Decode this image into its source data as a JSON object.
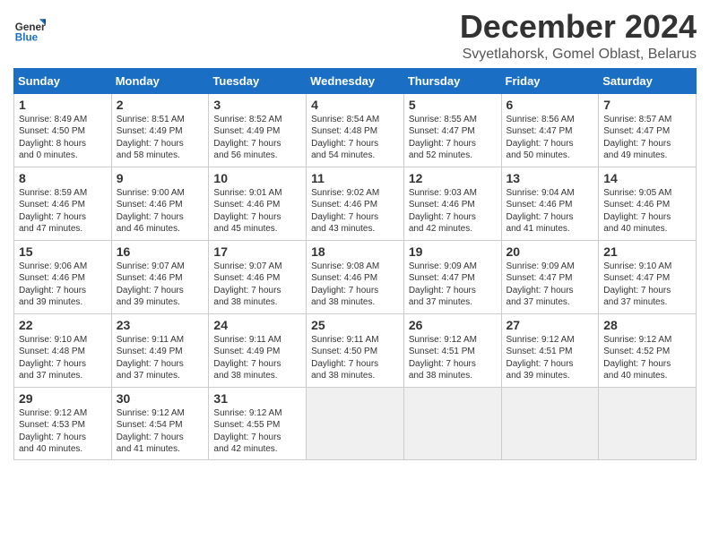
{
  "logo": {
    "general": "General",
    "blue": "Blue"
  },
  "title": "December 2024",
  "location": "Svyetlahorsk, Gomel Oblast, Belarus",
  "days_header": [
    "Sunday",
    "Monday",
    "Tuesday",
    "Wednesday",
    "Thursday",
    "Friday",
    "Saturday"
  ],
  "weeks": [
    [
      {
        "day": "1",
        "info": "Sunrise: 8:49 AM\nSunset: 4:50 PM\nDaylight: 8 hours\nand 0 minutes."
      },
      {
        "day": "2",
        "info": "Sunrise: 8:51 AM\nSunset: 4:49 PM\nDaylight: 7 hours\nand 58 minutes."
      },
      {
        "day": "3",
        "info": "Sunrise: 8:52 AM\nSunset: 4:49 PM\nDaylight: 7 hours\nand 56 minutes."
      },
      {
        "day": "4",
        "info": "Sunrise: 8:54 AM\nSunset: 4:48 PM\nDaylight: 7 hours\nand 54 minutes."
      },
      {
        "day": "5",
        "info": "Sunrise: 8:55 AM\nSunset: 4:47 PM\nDaylight: 7 hours\nand 52 minutes."
      },
      {
        "day": "6",
        "info": "Sunrise: 8:56 AM\nSunset: 4:47 PM\nDaylight: 7 hours\nand 50 minutes."
      },
      {
        "day": "7",
        "info": "Sunrise: 8:57 AM\nSunset: 4:47 PM\nDaylight: 7 hours\nand 49 minutes."
      }
    ],
    [
      {
        "day": "8",
        "info": "Sunrise: 8:59 AM\nSunset: 4:46 PM\nDaylight: 7 hours\nand 47 minutes."
      },
      {
        "day": "9",
        "info": "Sunrise: 9:00 AM\nSunset: 4:46 PM\nDaylight: 7 hours\nand 46 minutes."
      },
      {
        "day": "10",
        "info": "Sunrise: 9:01 AM\nSunset: 4:46 PM\nDaylight: 7 hours\nand 45 minutes."
      },
      {
        "day": "11",
        "info": "Sunrise: 9:02 AM\nSunset: 4:46 PM\nDaylight: 7 hours\nand 43 minutes."
      },
      {
        "day": "12",
        "info": "Sunrise: 9:03 AM\nSunset: 4:46 PM\nDaylight: 7 hours\nand 42 minutes."
      },
      {
        "day": "13",
        "info": "Sunrise: 9:04 AM\nSunset: 4:46 PM\nDaylight: 7 hours\nand 41 minutes."
      },
      {
        "day": "14",
        "info": "Sunrise: 9:05 AM\nSunset: 4:46 PM\nDaylight: 7 hours\nand 40 minutes."
      }
    ],
    [
      {
        "day": "15",
        "info": "Sunrise: 9:06 AM\nSunset: 4:46 PM\nDaylight: 7 hours\nand 39 minutes."
      },
      {
        "day": "16",
        "info": "Sunrise: 9:07 AM\nSunset: 4:46 PM\nDaylight: 7 hours\nand 39 minutes."
      },
      {
        "day": "17",
        "info": "Sunrise: 9:07 AM\nSunset: 4:46 PM\nDaylight: 7 hours\nand 38 minutes."
      },
      {
        "day": "18",
        "info": "Sunrise: 9:08 AM\nSunset: 4:46 PM\nDaylight: 7 hours\nand 38 minutes."
      },
      {
        "day": "19",
        "info": "Sunrise: 9:09 AM\nSunset: 4:47 PM\nDaylight: 7 hours\nand 37 minutes."
      },
      {
        "day": "20",
        "info": "Sunrise: 9:09 AM\nSunset: 4:47 PM\nDaylight: 7 hours\nand 37 minutes."
      },
      {
        "day": "21",
        "info": "Sunrise: 9:10 AM\nSunset: 4:47 PM\nDaylight: 7 hours\nand 37 minutes."
      }
    ],
    [
      {
        "day": "22",
        "info": "Sunrise: 9:10 AM\nSunset: 4:48 PM\nDaylight: 7 hours\nand 37 minutes."
      },
      {
        "day": "23",
        "info": "Sunrise: 9:11 AM\nSunset: 4:49 PM\nDaylight: 7 hours\nand 37 minutes."
      },
      {
        "day": "24",
        "info": "Sunrise: 9:11 AM\nSunset: 4:49 PM\nDaylight: 7 hours\nand 38 minutes."
      },
      {
        "day": "25",
        "info": "Sunrise: 9:11 AM\nSunset: 4:50 PM\nDaylight: 7 hours\nand 38 minutes."
      },
      {
        "day": "26",
        "info": "Sunrise: 9:12 AM\nSunset: 4:51 PM\nDaylight: 7 hours\nand 38 minutes."
      },
      {
        "day": "27",
        "info": "Sunrise: 9:12 AM\nSunset: 4:51 PM\nDaylight: 7 hours\nand 39 minutes."
      },
      {
        "day": "28",
        "info": "Sunrise: 9:12 AM\nSunset: 4:52 PM\nDaylight: 7 hours\nand 40 minutes."
      }
    ],
    [
      {
        "day": "29",
        "info": "Sunrise: 9:12 AM\nSunset: 4:53 PM\nDaylight: 7 hours\nand 40 minutes."
      },
      {
        "day": "30",
        "info": "Sunrise: 9:12 AM\nSunset: 4:54 PM\nDaylight: 7 hours\nand 41 minutes."
      },
      {
        "day": "31",
        "info": "Sunrise: 9:12 AM\nSunset: 4:55 PM\nDaylight: 7 hours\nand 42 minutes."
      },
      {
        "day": "",
        "info": ""
      },
      {
        "day": "",
        "info": ""
      },
      {
        "day": "",
        "info": ""
      },
      {
        "day": "",
        "info": ""
      }
    ]
  ]
}
